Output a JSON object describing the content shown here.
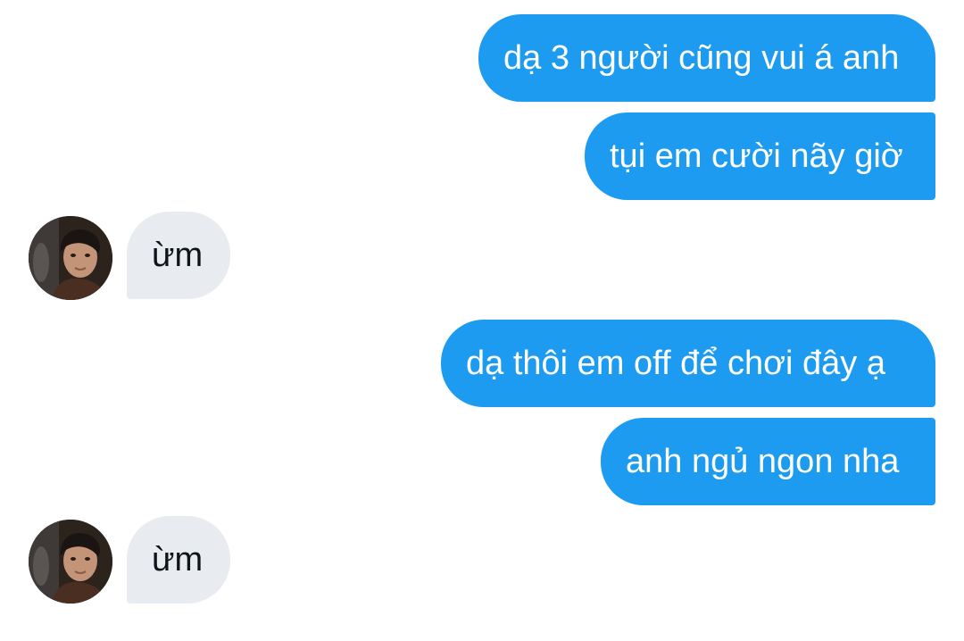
{
  "conversation": {
    "messages": [
      {
        "direction": "outgoing",
        "text": "dạ 3 người cũng vui á anh"
      },
      {
        "direction": "outgoing",
        "text": "tụi em cười nãy giờ"
      },
      {
        "direction": "incoming",
        "text": "ừm"
      },
      {
        "direction": "outgoing",
        "text": "dạ thôi em off để chơi đây ạ"
      },
      {
        "direction": "outgoing",
        "text": "anh ngủ ngon nha"
      },
      {
        "direction": "incoming",
        "text": "ừm"
      }
    ]
  },
  "colors": {
    "outgoing_bubble": "#1d9bf0",
    "incoming_bubble": "#e8ecf0",
    "outgoing_text": "#ffffff",
    "incoming_text": "#0f1419",
    "background": "#ffffff"
  }
}
